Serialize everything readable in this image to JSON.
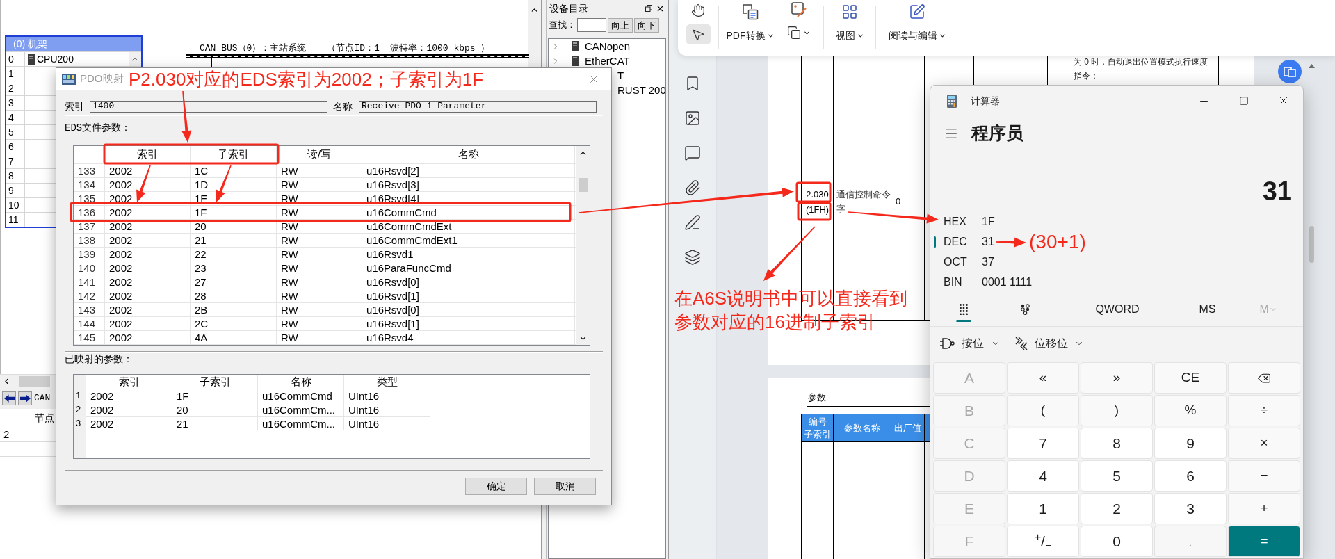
{
  "plc_app": {
    "rack": {
      "title": "(0) 机架",
      "slots": [
        {
          "number": "0",
          "module": "CPU200"
        },
        {
          "number": "1"
        },
        {
          "number": "2"
        },
        {
          "number": "3"
        },
        {
          "number": "4"
        },
        {
          "number": "5"
        },
        {
          "number": "6"
        },
        {
          "number": "7"
        },
        {
          "number": "8"
        },
        {
          "number": "9"
        },
        {
          "number": "10"
        },
        {
          "number": "11"
        }
      ]
    },
    "bus": {
      "title": "CAN BUS（0）：主站系统",
      "details": "（节点ID：1  波特率：1000 kbps ）"
    },
    "catalog": {
      "title": "设备目录",
      "search_label": "查找：",
      "buttons": [
        "向上",
        "向下"
      ],
      "items": [
        "CANopen",
        "EtherCAT",
        "T",
        "RUST 200"
      ]
    },
    "bottom_panel": {
      "tab": "CAN",
      "column_1": "节点",
      "rows": [
        "2"
      ]
    }
  },
  "pdo_dialog": {
    "title": "PDO映射",
    "index_label": "索引",
    "index_value": "1400",
    "name_label": "名称",
    "name_value": "Receive PDO 1 Parameter",
    "eds_label": "EDS文件参数：",
    "eds_table": {
      "columns": [
        "索引",
        "子索引",
        "读/写",
        "名称"
      ],
      "rows": [
        {
          "number": "133",
          "index": "2002",
          "subindex": "1C",
          "access": "RW",
          "name": "u16Rsvd[2]"
        },
        {
          "number": "134",
          "index": "2002",
          "subindex": "1D",
          "access": "RW",
          "name": "u16Rsvd[3]"
        },
        {
          "number": "135",
          "index": "2002",
          "subindex": "1E",
          "access": "RW",
          "name": "u16Rsvd[4]"
        },
        {
          "number": "136",
          "index": "2002",
          "subindex": "1F",
          "access": "RW",
          "name": "u16CommCmd"
        },
        {
          "number": "137",
          "index": "2002",
          "subindex": "20",
          "access": "RW",
          "name": "u16CommCmdExt"
        },
        {
          "number": "138",
          "index": "2002",
          "subindex": "21",
          "access": "RW",
          "name": "u16CommCmdExt1"
        },
        {
          "number": "139",
          "index": "2002",
          "subindex": "22",
          "access": "RW",
          "name": "u16Rsvd1"
        },
        {
          "number": "140",
          "index": "2002",
          "subindex": "23",
          "access": "RW",
          "name": "u16ParaFuncCmd"
        },
        {
          "number": "141",
          "index": "2002",
          "subindex": "27",
          "access": "RW",
          "name": "u16Rsvd[0]"
        },
        {
          "number": "142",
          "index": "2002",
          "subindex": "28",
          "access": "RW",
          "name": "u16Rsvd[1]"
        },
        {
          "number": "143",
          "index": "2002",
          "subindex": "2B",
          "access": "RW",
          "name": "u16Rsvd[0]"
        },
        {
          "number": "144",
          "index": "2002",
          "subindex": "2C",
          "access": "RW",
          "name": "u16Rsvd[1]"
        },
        {
          "number": "145",
          "index": "2002",
          "subindex": "4A",
          "access": "RW",
          "name": "u16Rsvd4"
        }
      ]
    },
    "mapped_label": "已映射的参数：",
    "mapped_table": {
      "columns": [
        "索引",
        "子索引",
        "名称",
        "类型"
      ],
      "rows": [
        {
          "number": "1",
          "index": "2002",
          "subindex": "1F",
          "name": "u16CommCmd",
          "type": "UInt16"
        },
        {
          "number": "2",
          "index": "2002",
          "subindex": "20",
          "name": "u16CommCm...",
          "type": "UInt16"
        },
        {
          "number": "3",
          "index": "2002",
          "subindex": "21",
          "name": "u16CommCm...",
          "type": "UInt16"
        }
      ]
    },
    "buttons": [
      "确定",
      "取消"
    ]
  },
  "pdf_viewer": {
    "toolbar": {
      "tools": [
        {
          "kind": "hand",
          "selected": false
        },
        {
          "kind": "pointer",
          "selected": true
        }
      ],
      "convert_label": "PDF转换",
      "view_label": "视图",
      "edit_label": "阅读与编辑"
    },
    "page_1": {
      "note_lines": [
        "为 0 时，自动退出位置模式执行速度",
        "指令："
      ],
      "parameter": {
        "number_lines": [
          "2.030",
          "(1FH)"
        ],
        "name_lines": [
          "通信控制命令",
          "字"
        ],
        "default": "0"
      }
    },
    "page_2": {
      "section_title": "参数",
      "columns": [
        {
          "lines": [
            "编号",
            "子索引"
          ]
        },
        {
          "lines": [
            "参数名称"
          ]
        },
        {
          "lines": [
            "出厂值"
          ]
        }
      ]
    }
  },
  "calculator": {
    "title": "计算器",
    "mode": "程序员",
    "display": "31",
    "radixes": [
      {
        "name": "HEX",
        "value": "1F",
        "selected": false
      },
      {
        "name": "DEC",
        "value": "31",
        "selected": true
      },
      {
        "name": "OCT",
        "value": "37",
        "selected": false
      },
      {
        "name": "BIN",
        "value": "0001 1111",
        "selected": false
      }
    ],
    "views": [
      {
        "kind": "keypad",
        "selected": true
      },
      {
        "kind": "bits",
        "selected": false
      }
    ],
    "word_size": "QWORD",
    "memory": [
      {
        "label": "MS",
        "disabled": false
      },
      {
        "label": "M",
        "disabled": true,
        "dropdown": true
      }
    ],
    "menus": [
      {
        "kind": "bitwise",
        "label": "按位"
      },
      {
        "kind": "shift",
        "label": "位移位"
      }
    ],
    "keys": [
      [
        {
          "label": "A",
          "kind": "digit",
          "disabled": true
        },
        {
          "label": "«",
          "kind": "operator",
          "disabled": false
        },
        {
          "label": "»",
          "kind": "operator",
          "disabled": false
        },
        {
          "label": "CE",
          "kind": "operator",
          "disabled": false
        },
        {
          "kind": "backspace",
          "disabled": false
        }
      ],
      [
        {
          "label": "B",
          "kind": "digit",
          "disabled": true
        },
        {
          "label": "(",
          "kind": "operator",
          "disabled": false
        },
        {
          "label": ")",
          "kind": "operator",
          "disabled": false
        },
        {
          "label": "%",
          "kind": "operator",
          "disabled": false
        },
        {
          "label": "÷",
          "kind": "operator",
          "disabled": false
        }
      ],
      [
        {
          "label": "C",
          "kind": "digit",
          "disabled": true
        },
        {
          "label": "7",
          "kind": "digit",
          "disabled": false
        },
        {
          "label": "8",
          "kind": "digit",
          "disabled": false
        },
        {
          "label": "9",
          "kind": "digit",
          "disabled": false
        },
        {
          "label": "×",
          "kind": "operator",
          "disabled": false
        }
      ],
      [
        {
          "label": "D",
          "kind": "digit",
          "disabled": true
        },
        {
          "label": "4",
          "kind": "digit",
          "disabled": false
        },
        {
          "label": "5",
          "kind": "digit",
          "disabled": false
        },
        {
          "label": "6",
          "kind": "digit",
          "disabled": false
        },
        {
          "label": "−",
          "kind": "operator",
          "disabled": false
        }
      ],
      [
        {
          "label": "E",
          "kind": "digit",
          "disabled": true
        },
        {
          "label": "1",
          "kind": "digit",
          "disabled": false
        },
        {
          "label": "2",
          "kind": "digit",
          "disabled": false
        },
        {
          "label": "3",
          "kind": "digit",
          "disabled": false
        },
        {
          "label": "+",
          "kind": "operator",
          "disabled": false
        }
      ],
      [
        {
          "label": "F",
          "kind": "digit",
          "disabled": true
        },
        {
          "label": "$^{+}$/$_{−}$",
          "kind": "digit",
          "disabled": false
        },
        {
          "label": "0",
          "kind": "digit",
          "disabled": false
        },
        {
          "label": ".",
          "kind": "digit",
          "disabled": true
        },
        {
          "label": "=",
          "kind": "equals",
          "disabled": false
        }
      ]
    ]
  },
  "annotations": {
    "title_note": "P2.030对应的EDS索引为2002；子索引为1F",
    "manual_note": [
      "在A6S说明书中可以直接看到",
      "参数对应的16进制子索引"
    ],
    "sum_note": "(30+1)"
  }
}
